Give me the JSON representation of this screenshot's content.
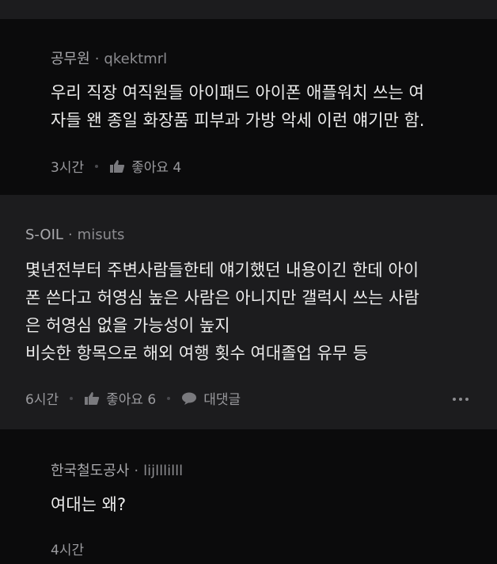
{
  "comments": [
    {
      "company": "공무원",
      "nickname": "qkektmrl",
      "lines": [
        "우리 직장 여직원들 아이패드 아이폰 애플워치 쓰는 여",
        "자들 왠 종일 화장품 피부과 가방 악세 이런 얘기만 함."
      ],
      "time": "3시간",
      "like_label": "좋아요 4"
    },
    {
      "company": "S-OIL",
      "nickname": "misuts",
      "lines": [
        "몇년전부터 주변사람들한테 얘기했던 내용이긴 한데 아이",
        "폰 쓴다고 허영심 높은 사람은 아니지만 갤럭시 쓰는 사람",
        "은 허영심 없을 가능성이 높지",
        "비슷한 항목으로 해외 여행 횟수 여대졸업 유무 등"
      ],
      "time": "6시간",
      "like_label": "좋아요 6",
      "reply_label": "대댓글"
    },
    {
      "company": "한국철도공사",
      "nickname": "lijlllilll",
      "lines": [
        "여대는 왜?"
      ],
      "time": "4시간"
    }
  ],
  "separator": "·",
  "icons": {
    "like": "thumbs-up-icon",
    "reply": "speech-bubble-icon",
    "more": "more-options-icon"
  }
}
